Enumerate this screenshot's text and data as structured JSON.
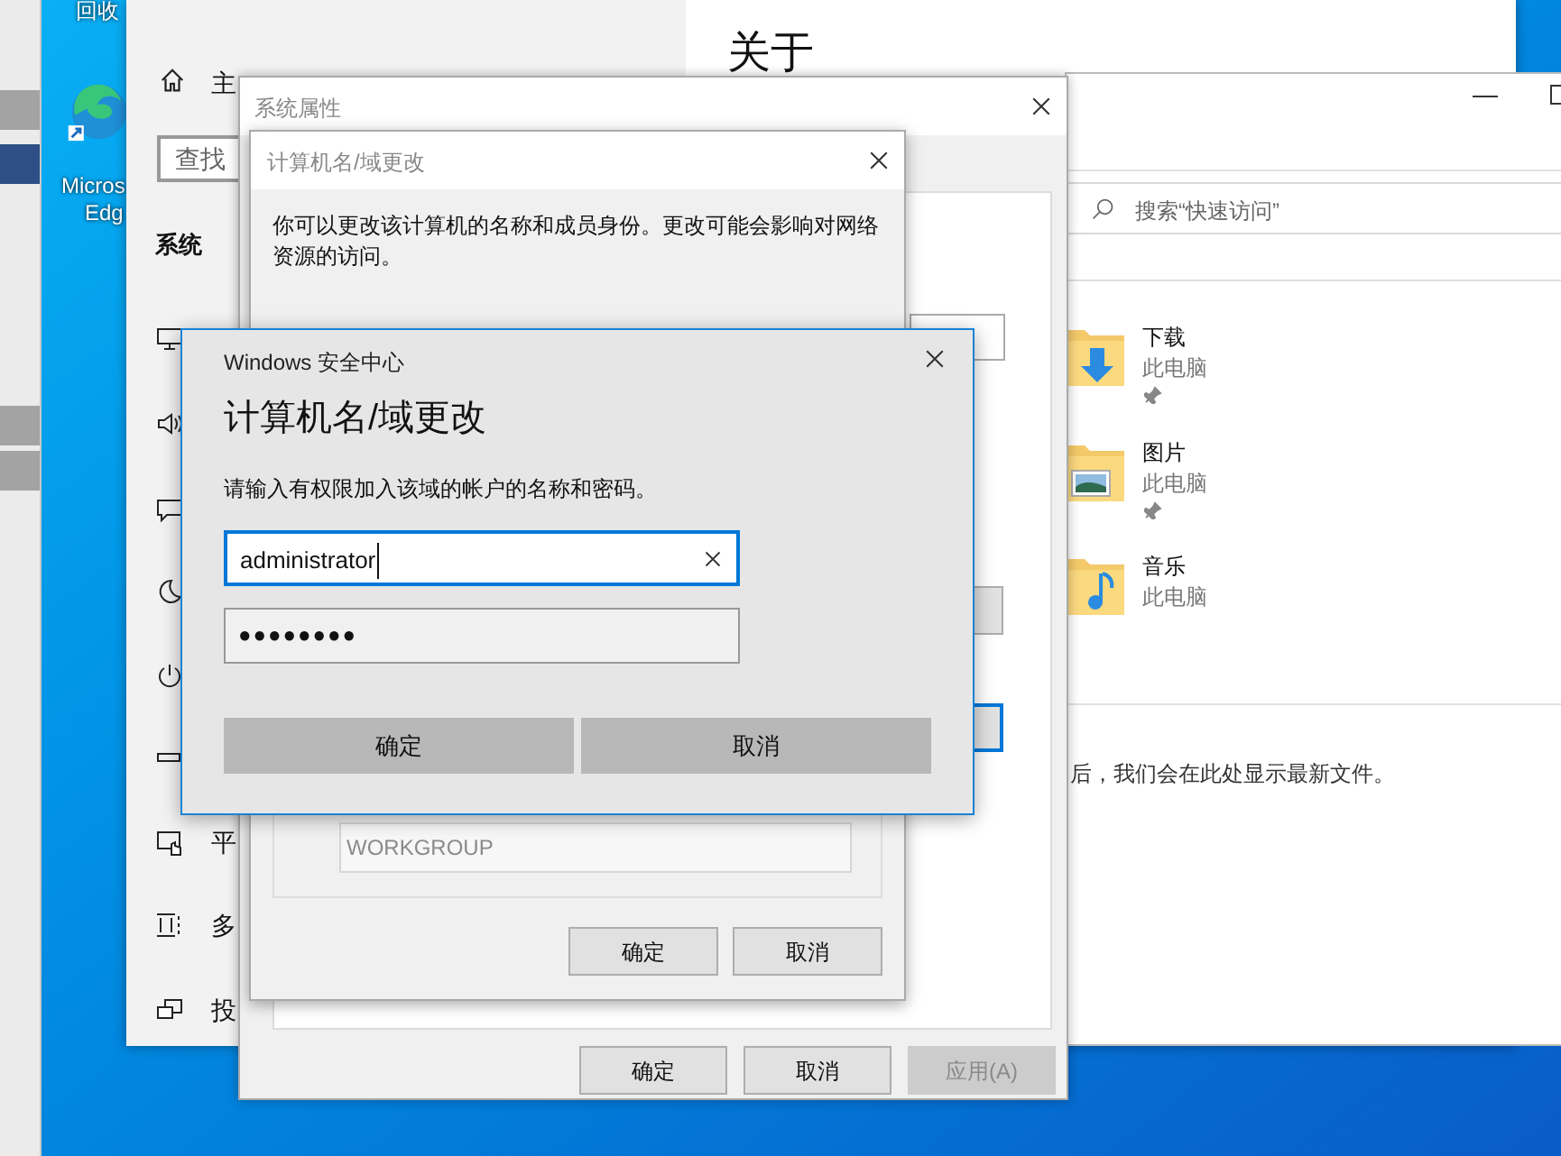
{
  "side_panel": {
    "tabs": [
      {
        "selected": false
      },
      {
        "selected": true
      },
      {
        "selected": false
      },
      {
        "selected": false
      }
    ]
  },
  "desktop": {
    "icons": [
      {
        "kind": "recycle",
        "lines": [
          "回收"
        ]
      },
      {
        "kind": "browser",
        "lines": [
          "Micros",
          "Edg"
        ]
      }
    ]
  },
  "settings": {
    "home": "主",
    "search_placeholder": "查找",
    "section": "系统",
    "about_heading": "关于",
    "nav": [
      {
        "kind": "display"
      },
      {
        "kind": "sound"
      },
      {
        "kind": "notifications"
      },
      {
        "kind": "moon"
      },
      {
        "kind": "power"
      },
      {
        "kind": "battery"
      },
      {
        "kind": "tablet",
        "label": "平"
      },
      {
        "kind": "multitask",
        "label": "多"
      },
      {
        "kind": "project",
        "label": "投"
      }
    ]
  },
  "explorer": {
    "search_placeholder": "搜索“快速访问”",
    "quick_access": [
      {
        "kind": "downloads",
        "name": "下载",
        "location": "此电脑",
        "pinned": true
      },
      {
        "kind": "pictures",
        "name": "图片",
        "location": "此电脑",
        "pinned": true
      },
      {
        "kind": "music",
        "name": "音乐",
        "location": "此电脑",
        "pinned": false
      }
    ],
    "recent_note": "后，我们会在此处显示最新文件。"
  },
  "system_properties": {
    "title": "系统属性",
    "buttons": [
      {
        "label": "确定",
        "disabled": false
      },
      {
        "label": "取消",
        "disabled": false
      },
      {
        "label": "应用(A)",
        "disabled": true
      }
    ]
  },
  "name_change": {
    "title": "计算机名/域更改",
    "description": "你可以更改该计算机的名称和成员身份。更改可能会影响对网络资源的访问。",
    "workgroup": "WORKGROUP",
    "buttons": [
      "确定",
      "取消"
    ]
  },
  "security": {
    "app": "Windows 安全中心",
    "heading": "计算机名/域更改",
    "prompt": "请输入有权限加入该域的帐户的名称和密码。",
    "username": "administrator",
    "password": "●●●●●●●●",
    "buttons": [
      "确定",
      "取消"
    ]
  }
}
